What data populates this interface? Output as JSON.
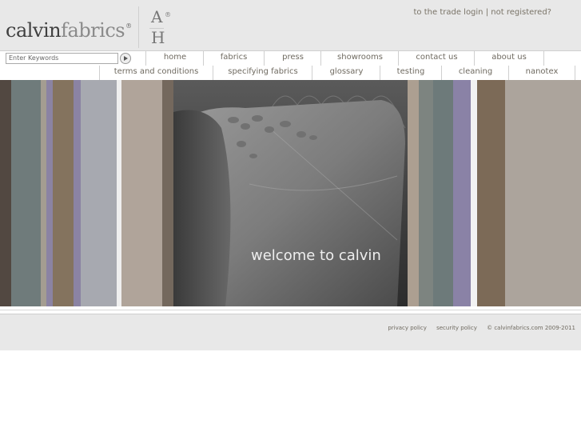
{
  "brand": {
    "part1": "calvin",
    "part2": "fabrics",
    "reg": "®",
    "ah_top": "A",
    "ah_bottom": "H",
    "ah_reg": "®"
  },
  "header": {
    "trade_login": "to the trade login",
    "separator": "|",
    "register": "not registered?"
  },
  "search": {
    "placeholder": "Enter Keywords"
  },
  "nav_main": [
    {
      "label": "home"
    },
    {
      "label": "fabrics"
    },
    {
      "label": "press"
    },
    {
      "label": "showrooms"
    },
    {
      "label": "contact us"
    },
    {
      "label": "about us"
    }
  ],
  "nav_sub": [
    {
      "label": "terms and conditions"
    },
    {
      "label": "specifying fabrics"
    },
    {
      "label": "glossary"
    },
    {
      "label": "testing"
    },
    {
      "label": "cleaning"
    },
    {
      "label": "nanotex"
    }
  ],
  "hero": {
    "welcome": "welcome to calvin"
  },
  "footer": {
    "privacy": "privacy policy",
    "security": "security policy",
    "copyright": "© calvinfabrics.com 2009-2011"
  },
  "colors": {
    "header_bg": "#e8e8e8",
    "stripes": [
      "#524841",
      "#6f7b7b",
      "#a49d91",
      "#8b83a3",
      "#84735e",
      "#8b83a3",
      "#a7a9b0",
      "#efefef",
      "#b0a49a",
      "#74685d",
      "#ac9f91",
      "#7d8480",
      "#6d7a7a",
      "#8a82a6",
      "#f2f2f2",
      "#7c6a57",
      "#aca49c"
    ]
  }
}
